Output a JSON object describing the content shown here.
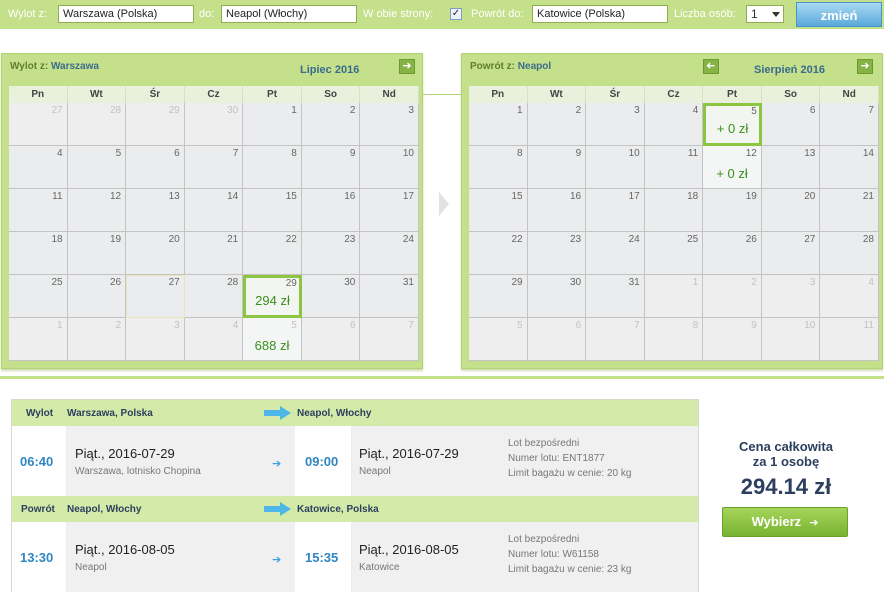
{
  "search": {
    "from_label": "Wylot z:",
    "from_value": "Warszawa (Polska)",
    "to_label": "do:",
    "to_value": "Neapol (Włochy)",
    "both_ways_label": "W obie strony:",
    "both_ways_checked": "✓",
    "return_label": "Powrót do:",
    "return_value": "Katowice (Polska)",
    "persons_label": "Liczba osób:",
    "persons_value": "1",
    "change_button": "zmień"
  },
  "outbound_calendar": {
    "header_prefix": "Wylot z:",
    "header_city": "Warszawa",
    "month": "Lipiec 2016",
    "next_icon": "arrow-right-icon",
    "weekdays": [
      "Pn",
      "Wt",
      "Śr",
      "Cz",
      "Pt",
      "So",
      "Nd"
    ],
    "weeks": [
      [
        {
          "n": "27",
          "m": true
        },
        {
          "n": "28",
          "m": true
        },
        {
          "n": "29",
          "m": true
        },
        {
          "n": "30",
          "m": true
        },
        {
          "n": "1"
        },
        {
          "n": "2"
        },
        {
          "n": "3"
        }
      ],
      [
        {
          "n": "4"
        },
        {
          "n": "5"
        },
        {
          "n": "6"
        },
        {
          "n": "7"
        },
        {
          "n": "8"
        },
        {
          "n": "9"
        },
        {
          "n": "10"
        }
      ],
      [
        {
          "n": "11"
        },
        {
          "n": "12"
        },
        {
          "n": "13"
        },
        {
          "n": "14"
        },
        {
          "n": "15"
        },
        {
          "n": "16"
        },
        {
          "n": "17"
        }
      ],
      [
        {
          "n": "18"
        },
        {
          "n": "19"
        },
        {
          "n": "20"
        },
        {
          "n": "21"
        },
        {
          "n": "22"
        },
        {
          "n": "23"
        },
        {
          "n": "24"
        }
      ],
      [
        {
          "n": "25"
        },
        {
          "n": "26"
        },
        {
          "n": "27"
        },
        {
          "n": "28"
        },
        {
          "n": "29",
          "p": "294 zł",
          "s": true
        },
        {
          "n": "30"
        },
        {
          "n": "31"
        }
      ],
      [
        {
          "n": "1",
          "m": true
        },
        {
          "n": "2",
          "m": true
        },
        {
          "n": "3",
          "m": true
        },
        {
          "n": "4",
          "m": true
        },
        {
          "n": "5",
          "m": true,
          "p": "688 zł"
        },
        {
          "n": "6",
          "m": true
        },
        {
          "n": "7",
          "m": true
        }
      ]
    ]
  },
  "return_calendar": {
    "header_prefix": "Powrót z:",
    "header_city": "Neapol",
    "month": "Sierpień 2016",
    "prev_icon": "arrow-left-icon",
    "next_icon": "arrow-right-icon",
    "weekdays": [
      "Pn",
      "Wt",
      "Śr",
      "Cz",
      "Pt",
      "So",
      "Nd"
    ],
    "weeks": [
      [
        {
          "n": "1"
        },
        {
          "n": "2"
        },
        {
          "n": "3"
        },
        {
          "n": "4"
        },
        {
          "n": "5",
          "p": "+ 0 zł",
          "s": true
        },
        {
          "n": "6"
        },
        {
          "n": "7"
        }
      ],
      [
        {
          "n": "8"
        },
        {
          "n": "9"
        },
        {
          "n": "10"
        },
        {
          "n": "11"
        },
        {
          "n": "12",
          "p": "+ 0 zł"
        },
        {
          "n": "13"
        },
        {
          "n": "14"
        }
      ],
      [
        {
          "n": "15"
        },
        {
          "n": "16"
        },
        {
          "n": "17"
        },
        {
          "n": "18"
        },
        {
          "n": "19"
        },
        {
          "n": "20"
        },
        {
          "n": "21"
        }
      ],
      [
        {
          "n": "22"
        },
        {
          "n": "23"
        },
        {
          "n": "24"
        },
        {
          "n": "25"
        },
        {
          "n": "26"
        },
        {
          "n": "27"
        },
        {
          "n": "28"
        }
      ],
      [
        {
          "n": "29"
        },
        {
          "n": "30"
        },
        {
          "n": "31"
        },
        {
          "n": "1",
          "m": true
        },
        {
          "n": "2",
          "m": true
        },
        {
          "n": "3",
          "m": true
        },
        {
          "n": "4",
          "m": true
        }
      ],
      [
        {
          "n": "5",
          "m": true
        },
        {
          "n": "6",
          "m": true
        },
        {
          "n": "7",
          "m": true
        },
        {
          "n": "8",
          "m": true
        },
        {
          "n": "9",
          "m": true
        },
        {
          "n": "10",
          "m": true
        },
        {
          "n": "11",
          "m": true
        }
      ]
    ]
  },
  "outbound": {
    "label": "Wylot",
    "from": "Warszawa, Polska",
    "to": "Neapol, Włochy",
    "dep_time": "06:40",
    "dep_day": "Piąt.",
    "dep_date": "2016-07-29",
    "dep_place": "Warszawa, lotnisko Chopina",
    "arr_time": "09:00",
    "arr_day": "Piąt.",
    "arr_date": "2016-07-29",
    "arr_place": "Neapol",
    "direct": "Lot bezpośredni",
    "flight_no": "Numer lotu: ENT1877",
    "baggage": "Limit bagażu w cenie: 20 kg"
  },
  "inbound": {
    "label": "Powrót",
    "from": "Neapol, Włochy",
    "to": "Katowice, Polska",
    "dep_time": "13:30",
    "dep_day": "Piąt.",
    "dep_date": "2016-08-05",
    "dep_place": "Neapol",
    "arr_time": "15:35",
    "arr_day": "Piąt.",
    "arr_date": "2016-08-05",
    "arr_place": "Katowice",
    "direct": "Lot bezpośredni",
    "flight_no": "Numer lotu: W61158",
    "baggage": "Limit bagażu w cenie: 23 kg"
  },
  "summary": {
    "total_label_1": "Cena całkowita",
    "total_label_2": "za 1 osobę",
    "amount": "294.14 zł",
    "choose_button": "Wybierz",
    "choose_icon": "arrow-right-icon"
  },
  "colors": {
    "accent_green": "#c5e08b",
    "price_green": "#3a8f1e",
    "time_blue": "#2f86c2",
    "button_blue": "#5aa9db"
  }
}
